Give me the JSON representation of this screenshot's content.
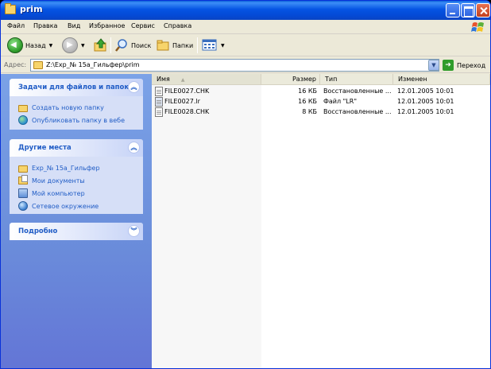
{
  "window": {
    "title": "prim"
  },
  "menu": [
    "Файл",
    "Правка",
    "Вид",
    "Избранное",
    "Сервис",
    "Справка"
  ],
  "toolbar": {
    "back": "Назад",
    "search": "Поиск",
    "folders": "Папки"
  },
  "address": {
    "label": "Адрес:",
    "path": "Z:\\Exp_№ 15a_Гильфер\\prim",
    "go": "Переход"
  },
  "tasks_panel": {
    "title": "Задачи для файлов и папок",
    "items": [
      "Создать новую папку",
      "Опубликовать папку в вебе"
    ]
  },
  "places_panel": {
    "title": "Другие места",
    "items": [
      "Exp_№ 15a_Гильфер",
      "Мои документы",
      "Мой компьютер",
      "Сетевое окружение"
    ]
  },
  "details_panel": {
    "title": "Подробно"
  },
  "file_list": {
    "columns": [
      "Имя",
      "Размер",
      "Тип",
      "Изменен"
    ],
    "rows": [
      {
        "name": "FILE0027.CHK",
        "size": "16 КБ",
        "type": "Восстановленные ...",
        "modified": "12.01.2005 10:01"
      },
      {
        "name": "FILE0027.lr",
        "size": "16 КБ",
        "type": "Файл \"LR\"",
        "modified": "12.01.2005 10:01"
      },
      {
        "name": "FILE0028.CHK",
        "size": "8 КБ",
        "type": "Восстановленные ...",
        "modified": "12.01.2005 10:01"
      }
    ]
  },
  "colors": {
    "title_bar": "#0554e3",
    "task_pane": "#6b8edb",
    "link": "#215dc6"
  }
}
